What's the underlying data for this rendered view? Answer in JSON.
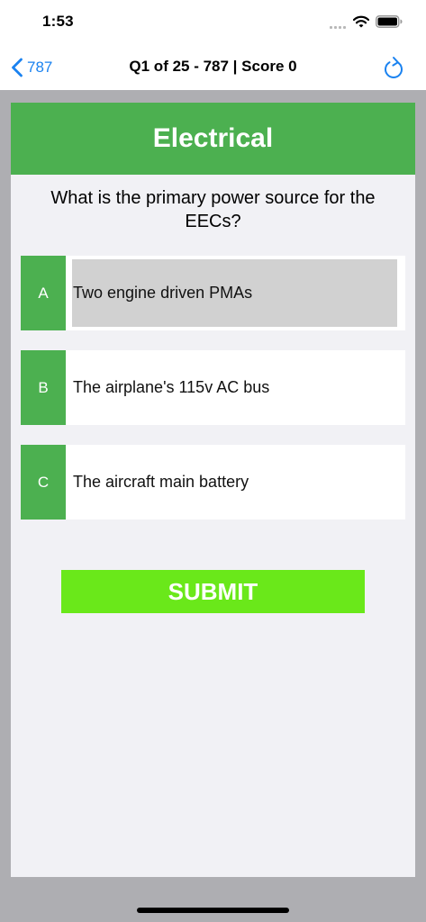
{
  "status_bar": {
    "time": "1:53",
    "icons": [
      "signal-icon",
      "wifi-icon",
      "battery-icon"
    ]
  },
  "nav": {
    "back_label": "787",
    "title": "Q1 of 25 - 787 | Score 0",
    "back_icon": "chevron-left-icon",
    "refresh_icon": "refresh-icon"
  },
  "quiz": {
    "category": "Electrical",
    "question": "What is the primary power source for the EECs?",
    "answers": [
      {
        "letter": "A",
        "text": "Two engine driven PMAs",
        "selected": true
      },
      {
        "letter": "B",
        "text": "The airplane's 115v AC bus",
        "selected": false
      },
      {
        "letter": "C",
        "text": "The aircraft main battery",
        "selected": false
      }
    ],
    "submit_label": "SUBMIT"
  },
  "colors": {
    "accent_blue": "#1a82f0",
    "header_green": "#4cb050",
    "submit_green": "#6ae81a",
    "frame_grey": "#aeaeb2",
    "card_bg": "#f1f1f5",
    "selected_bg": "#d1d1d1"
  }
}
